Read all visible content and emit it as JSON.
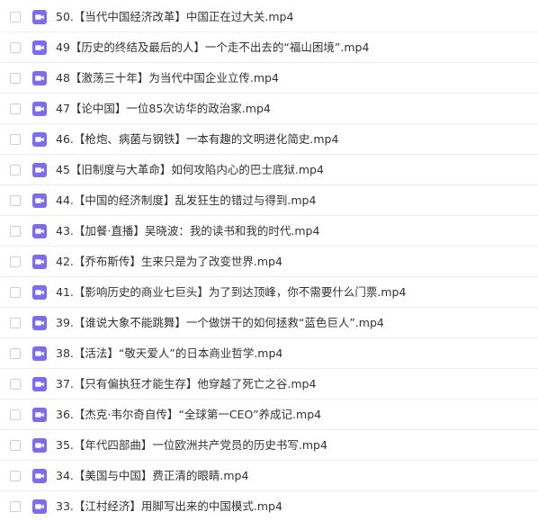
{
  "files": [
    {
      "name": "50.【当代中国经济改革】中国正在过大关.mp4"
    },
    {
      "name": "49【历史的终结及最后的人】一个走不出去的“福山困境”.mp4"
    },
    {
      "name": "48【激荡三十年】为当代中国企业立传.mp4"
    },
    {
      "name": "47【论中国】一位85次访华的政治家.mp4"
    },
    {
      "name": "46.【枪炮、病菌与钢铁】一本有趣的文明进化简史.mp4"
    },
    {
      "name": "45【旧制度与大革命】如何攻陷内心的巴士底狱.mp4"
    },
    {
      "name": "44.【中国的经济制度】乱发狂生的错过与得到.mp4"
    },
    {
      "name": "43.【加餐·直播】吴晓波：我的读书和我的时代.mp4"
    },
    {
      "name": "42.【乔布斯传】生来只是为了改变世界.mp4"
    },
    {
      "name": "41.【影响历史的商业七巨头】为了到达顶峰，你不需要什么门票.mp4"
    },
    {
      "name": "39.【谁说大象不能跳舞】一个做饼干的如何拯救“蓝色巨人”.mp4"
    },
    {
      "name": "38.【活法】“敬天爱人”的日本商业哲学.mp4"
    },
    {
      "name": "37.【只有偏执狂才能生存】他穿越了死亡之谷.mp4"
    },
    {
      "name": "36.【杰克·韦尔奇自传】“全球第一CEO”养成记.mp4"
    },
    {
      "name": "35.【年代四部曲】一位欧洲共产党员的历史书写.mp4"
    },
    {
      "name": "34.【美国与中国】费正清的眼睛.mp4"
    },
    {
      "name": "33.【江村经济】用脚写出来的中国模式.mp4"
    }
  ],
  "icon": "video-file-icon",
  "colors": {
    "icon_bg": "#7b6cf0",
    "text": "#333333",
    "divider": "#eeeeee"
  }
}
